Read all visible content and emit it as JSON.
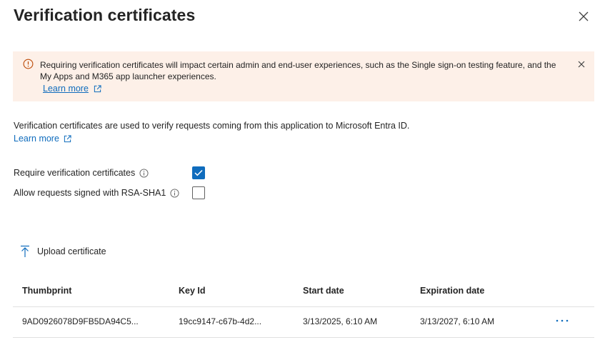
{
  "panel": {
    "title": "Verification certificates"
  },
  "banner": {
    "message": "Requiring verification certificates will impact certain admin and end-user experiences, such as the Single sign-on testing feature, and the My Apps and M365 app launcher experiences.",
    "link_label": "Learn more",
    "color": "#fdf0e8",
    "icon": "warning-circle-icon"
  },
  "description": {
    "text": "Verification certificates are used to verify requests coming from this application to Microsoft Entra ID.",
    "link_label": "Learn more"
  },
  "options": {
    "require_label": "Require verification certificates",
    "require_checked": true,
    "rsa_label": "Allow requests signed with RSA-SHA1",
    "rsa_checked": false
  },
  "toolbar": {
    "upload_label": "Upload certificate"
  },
  "table": {
    "headers": {
      "thumbprint": "Thumbprint",
      "key_id": "Key Id",
      "start_date": "Start date",
      "expiration_date": "Expiration date"
    },
    "rows": [
      {
        "thumbprint": "9AD0926078D9FB5DA94C5...",
        "key_id": "19cc9147-c67b-4d2...",
        "start_date": "3/13/2025, 6:10 AM",
        "expiration_date": "3/13/2027, 6:10 AM"
      }
    ]
  },
  "colors": {
    "accent": "#0f6cbd",
    "warning": "#bc4b09"
  }
}
